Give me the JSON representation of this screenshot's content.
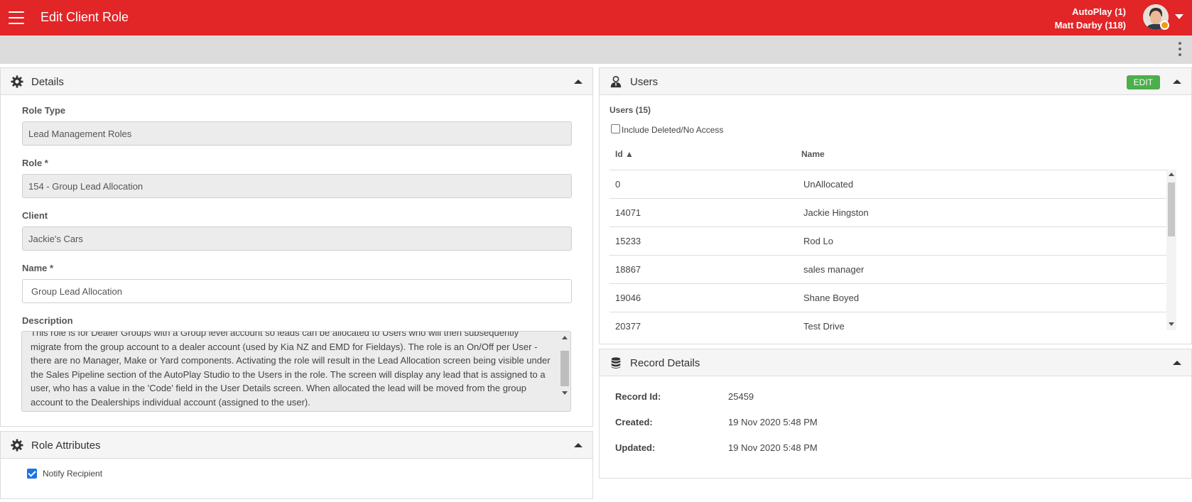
{
  "header": {
    "title": "Edit Client Role",
    "account_line": "AutoPlay (1)",
    "user_line": "Matt Darby (118)",
    "brand_color": "#e22527"
  },
  "details": {
    "title": "Details",
    "icon": "gear-icon",
    "role_type_label": "Role Type",
    "role_type_value": "Lead Management Roles",
    "role_label": "Role *",
    "role_value": "154 - Group Lead Allocation",
    "client_label": "Client",
    "client_value": "Jackie's Cars",
    "name_label": "Name *",
    "name_value": "Group Lead Allocation",
    "description_label": "Description",
    "description_lines": [
      "This role is for Dealer Groups with a Group level account so leads can be allocated to Users who will then subsequently",
      "migrate from the group account to a dealer account (used by Kia NZ and EMD for Fieldays). The role is an On/Off per User -",
      "there are no Manager, Make or Yard components. Activating the role will result in the Lead Allocation screen being visible under",
      "the Sales Pipeline section of the AutoPlay Studio to the Users in the role. The screen will display any lead that is assigned to a",
      "user, who has a value in the 'Code' field in the User Details screen. When allocated the lead will be moved from the group",
      "account to the Dealerships individual account (assigned to the user)."
    ]
  },
  "role_attributes": {
    "title": "Role Attributes",
    "notify_label": "Notify Recipient",
    "notify_checked": true
  },
  "users": {
    "title": "Users",
    "edit_label": "EDIT",
    "count_label": "Users (15)",
    "include_deleted_label": "Include Deleted/No Access",
    "col_id": "Id ▲",
    "col_name": "Name",
    "rows": [
      {
        "id": "0",
        "name": "UnAllocated"
      },
      {
        "id": "14071",
        "name": "Jackie Hingston"
      },
      {
        "id": "15233",
        "name": "Rod Lo"
      },
      {
        "id": "18867",
        "name": "sales manager"
      },
      {
        "id": "19046",
        "name": "Shane Boyed"
      },
      {
        "id": "20377",
        "name": "Test Drive"
      }
    ]
  },
  "record_details": {
    "title": "Record Details",
    "record_id_label": "Record Id:",
    "record_id_value": "25459",
    "created_label": "Created:",
    "created_value": "19 Nov 2020 5:48 PM",
    "updated_label": "Updated:",
    "updated_value": "19 Nov 2020 5:48 PM"
  }
}
